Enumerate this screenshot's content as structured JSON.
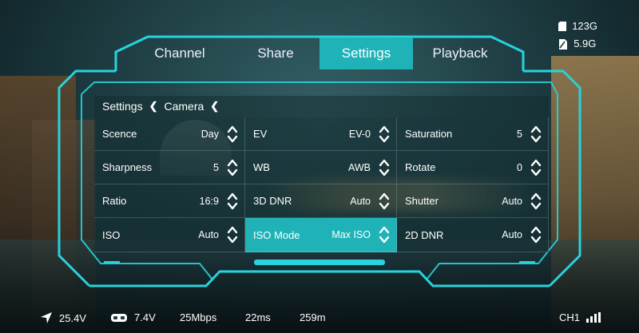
{
  "tabs": [
    {
      "label": "Channel",
      "active": false
    },
    {
      "label": "Share",
      "active": false
    },
    {
      "label": "Settings",
      "active": true
    },
    {
      "label": "Playback",
      "active": false
    }
  ],
  "storage": {
    "sd_label": "123G",
    "internal_label": "5.9G"
  },
  "breadcrumb": {
    "root": "Settings",
    "current": "Camera",
    "sep": "❮"
  },
  "settings": [
    {
      "label": "Scence",
      "value": "Day"
    },
    {
      "label": "EV",
      "value": "EV-0"
    },
    {
      "label": "Saturation",
      "value": "5"
    },
    {
      "label": "Sharpness",
      "value": "5"
    },
    {
      "label": "WB",
      "value": "AWB"
    },
    {
      "label": "Rotate",
      "value": "0"
    },
    {
      "label": "Ratio",
      "value": "16:9"
    },
    {
      "label": "3D DNR",
      "value": "Auto"
    },
    {
      "label": "Shutter",
      "value": "Auto"
    },
    {
      "label": "ISO",
      "value": "Auto"
    },
    {
      "label": "ISO Mode",
      "value": "Max ISO",
      "selected": true
    },
    {
      "label": "2D DNR",
      "value": "Auto"
    }
  ],
  "status": {
    "drone_voltage": "25.4V",
    "goggle_voltage": "7.4V",
    "bitrate": "25Mbps",
    "latency": "22ms",
    "distance": "259m",
    "channel": "CH1"
  },
  "colors": {
    "accent": "#1fb3b8",
    "frame": "#27d3dc"
  }
}
